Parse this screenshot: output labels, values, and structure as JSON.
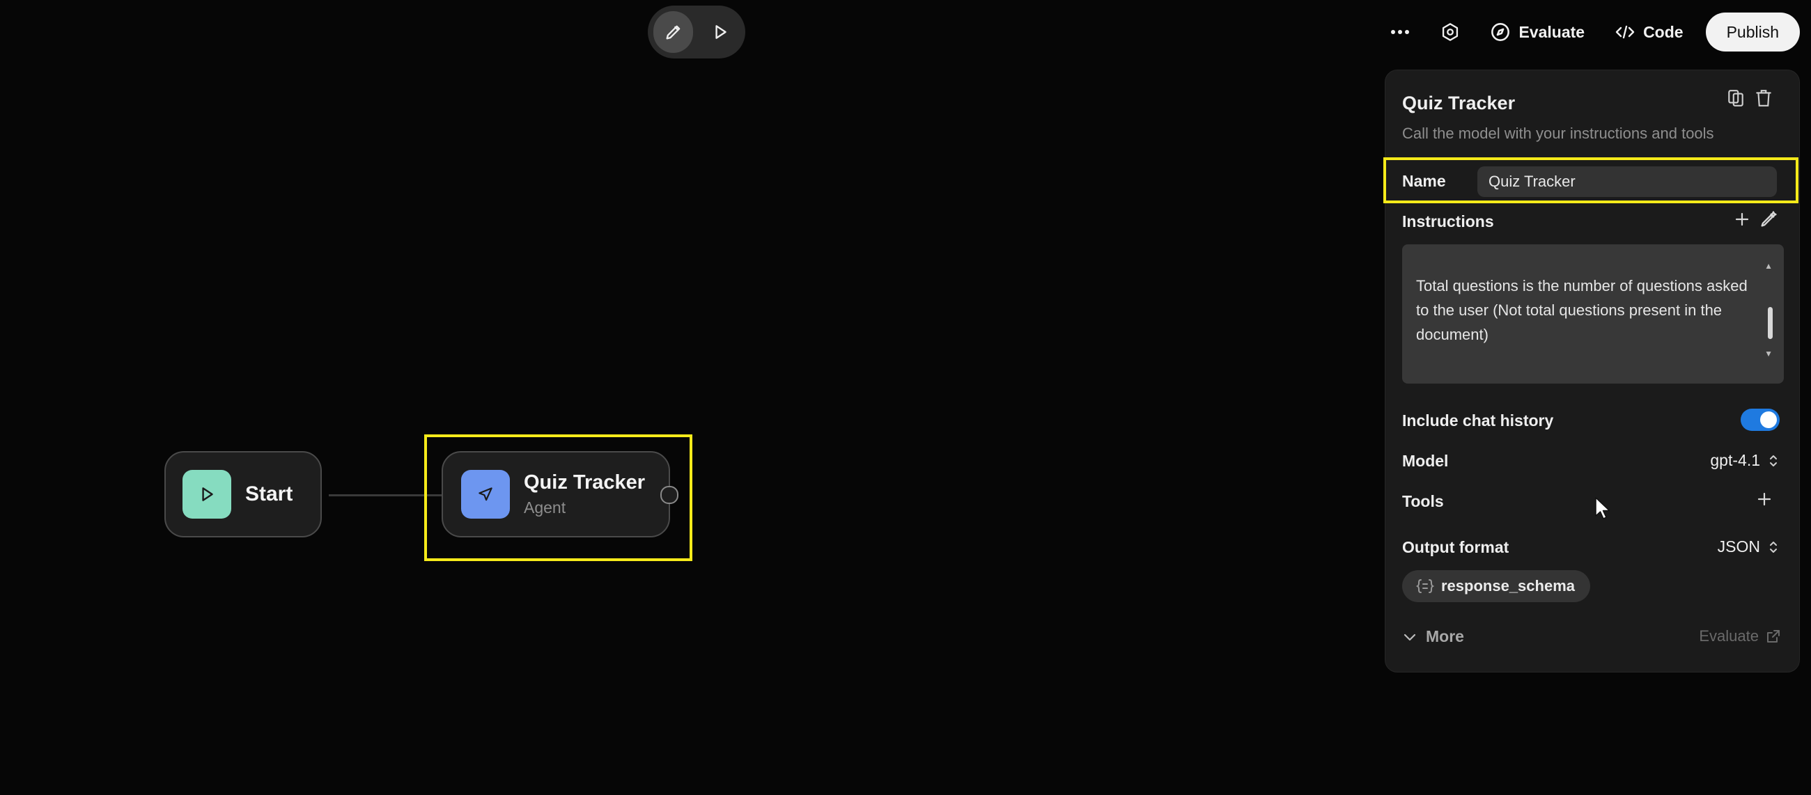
{
  "toolbar": {
    "evaluate_label": "Evaluate",
    "code_label": "Code",
    "publish_label": "Publish"
  },
  "nodes": {
    "start": {
      "title": "Start"
    },
    "agent": {
      "title": "Quiz Tracker",
      "subtitle": "Agent"
    }
  },
  "panel": {
    "title": "Quiz Tracker",
    "description": "Call the model with your instructions and tools",
    "name_label": "Name",
    "name_value": "Quiz Tracker",
    "instructions_label": "Instructions",
    "instructions_text": "Total questions is the number of questions asked to the user (Not total questions present in the document)",
    "include_history_label": "Include chat history",
    "include_history_on": true,
    "model_label": "Model",
    "model_value": "gpt-4.1",
    "tools_label": "Tools",
    "output_format_label": "Output format",
    "output_format_value": "JSON",
    "schema_chip": "response_schema",
    "more_label": "More",
    "evaluate_link": "Evaluate"
  },
  "colors": {
    "start_icon_bg": "#86dcc0",
    "agent_icon_bg": "#6d96f0",
    "highlight": "#f5ea1a",
    "toggle_on": "#1f7ae0"
  }
}
